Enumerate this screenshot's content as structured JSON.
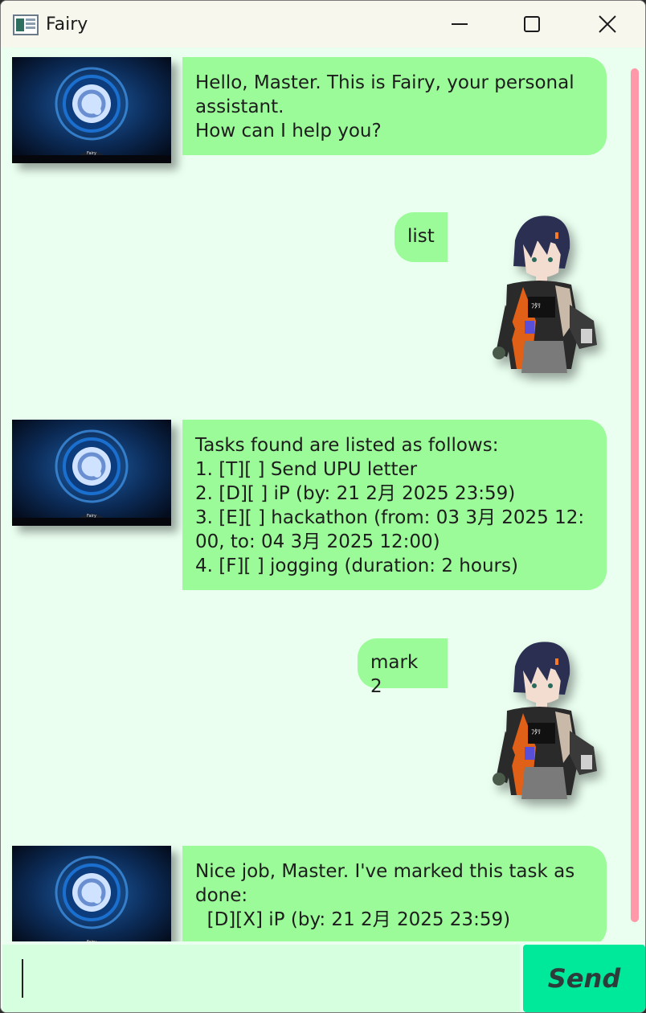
{
  "window": {
    "title": "Fairy"
  },
  "colors": {
    "background": "#eafff0",
    "bubble": "#9bfb98",
    "send": "#00e89a",
    "scroll_thumb": "#ff98a8",
    "input": "#d6ffe0"
  },
  "bot_avatar_caption": "Fairy",
  "messages": [
    {
      "sender": "bot",
      "text": "Hello, Master. This is Fairy, your personal\nassistant.\nHow can I help you?"
    },
    {
      "sender": "user",
      "text": "list"
    },
    {
      "sender": "bot",
      "text": "Tasks found are listed as follows:\n1. [T][ ] Send UPU letter\n2. [D][ ] iP (by: 21 2月 2025 23:59)\n3. [E][ ] hackathon (from: 03 3月 2025 12:\n00, to: 04 3月 2025 12:00)\n4. [F][ ] jogging (duration: 2 hours)"
    },
    {
      "sender": "user",
      "text": "mark 2"
    },
    {
      "sender": "bot",
      "text": "Nice job, Master. I've marked this task as\ndone:\n  [D][X] iP (by: 21 2月 2025 23:59)"
    }
  ],
  "input": {
    "value": "",
    "placeholder": ""
  },
  "send_button": {
    "label": "Send"
  },
  "icons": {
    "minimize": "minimize-icon",
    "maximize": "maximize-icon",
    "close": "close-icon",
    "app": "app-icon"
  }
}
